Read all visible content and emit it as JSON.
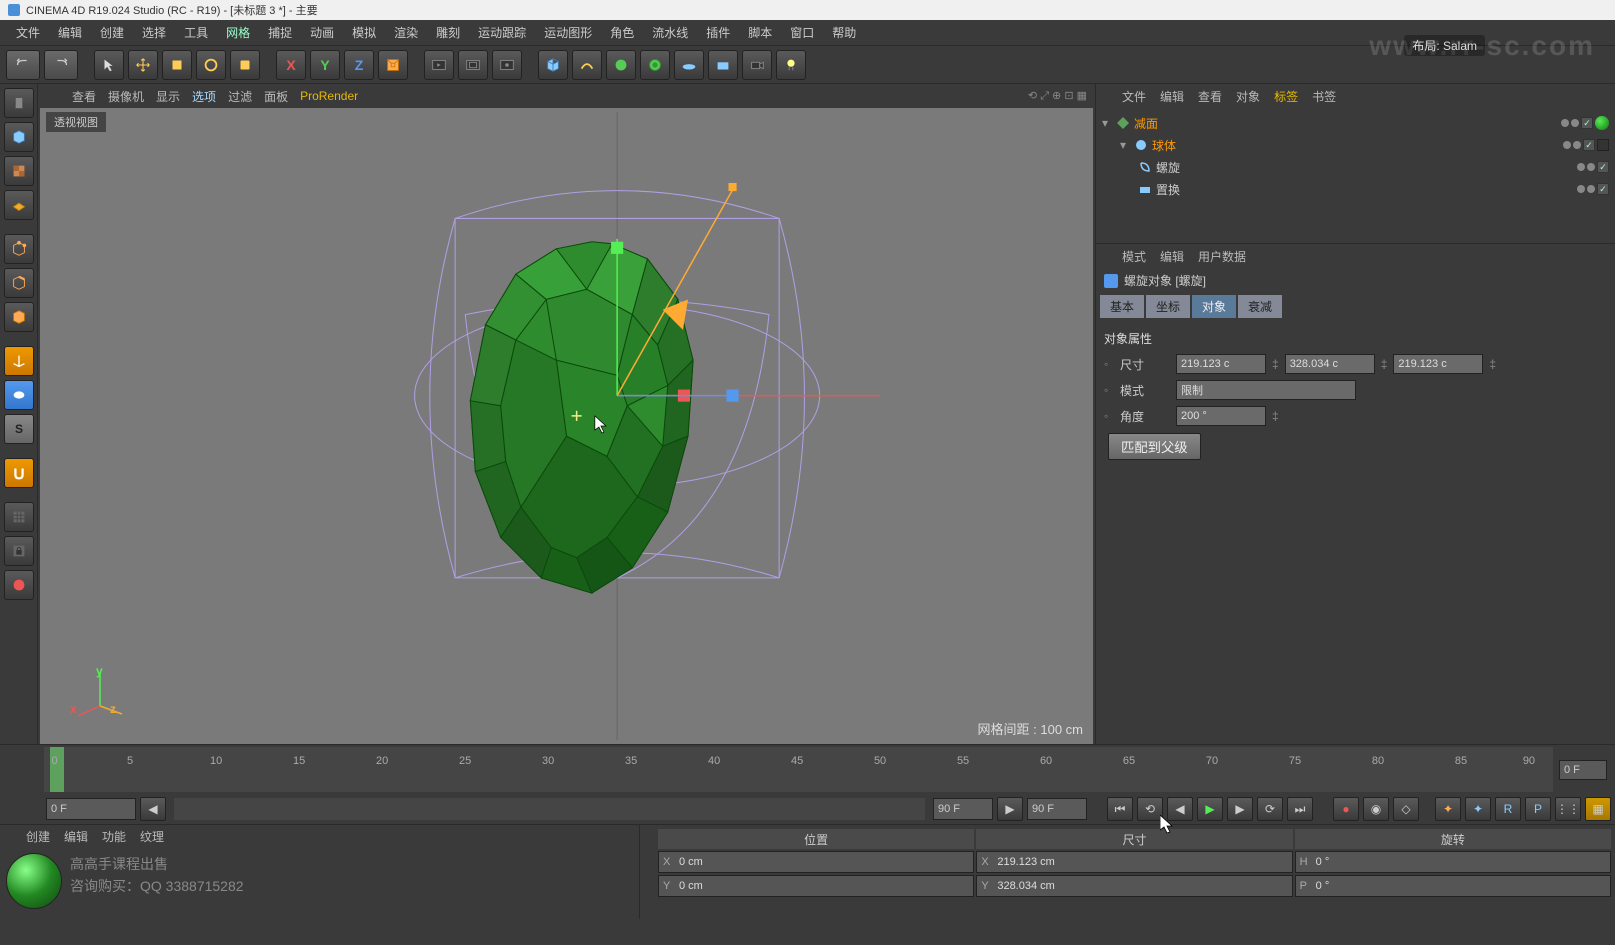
{
  "title": "CINEMA 4D R19.024 Studio (RC - R19) - [未标题 3 *] - 主要",
  "watermark": "www.rr-sc.com",
  "page_indicator": "布局: Salam",
  "menubar": [
    "文件",
    "编辑",
    "创建",
    "选择",
    "工具",
    "网格",
    "捕捉",
    "动画",
    "模拟",
    "渲染",
    "雕刻",
    "运动跟踪",
    "运动图形",
    "角色",
    "流水线",
    "插件",
    "脚本",
    "窗口",
    "帮助"
  ],
  "vp_menu": {
    "items": [
      "查看",
      "摄像机",
      "显示",
      "选项",
      "过滤",
      "面板"
    ],
    "prorender": "ProRender",
    "icons": "⟲ ⤢ ⊕ ⊡ ▦"
  },
  "viewport": {
    "label": "透视视图",
    "grid_info": "网格间距 : 100 cm"
  },
  "axis_gizmo": {
    "x": "x",
    "y": "y",
    "z": "z"
  },
  "obj_panel": {
    "menu": [
      "文件",
      "编辑",
      "查看",
      "对象",
      "标签",
      "书签"
    ],
    "tree": [
      {
        "name": "减面",
        "color": "orange",
        "indent": 0,
        "icon": "reduce"
      },
      {
        "name": "球体",
        "color": "orange",
        "indent": 1,
        "icon": "sphere"
      },
      {
        "name": "螺旋",
        "color": "normal",
        "indent": 2,
        "icon": "twist"
      },
      {
        "name": "置换",
        "color": "normal",
        "indent": 2,
        "icon": "displace"
      }
    ]
  },
  "attr_panel": {
    "menu": [
      "模式",
      "编辑",
      "用户数据"
    ],
    "title": "螺旋对象 [螺旋]",
    "tabs": [
      "基本",
      "坐标",
      "对象",
      "衰减"
    ],
    "section_title": "对象属性",
    "rows": {
      "size_label": "尺寸",
      "size_x": "219.123 c",
      "size_y": "328.034 c",
      "size_z": "219.123 c",
      "mode_label": "模式",
      "mode_value": "限制",
      "angle_label": "角度",
      "angle_value": "200 °"
    },
    "fit_btn": "匹配到父级"
  },
  "timeline": {
    "ticks": [
      "0",
      "5",
      "10",
      "15",
      "20",
      "25",
      "30",
      "35",
      "40",
      "45",
      "50",
      "55",
      "60",
      "65",
      "70",
      "75",
      "80",
      "85",
      "90"
    ],
    "end": "0 F",
    "range_start": "0 F",
    "range_end": "90 F",
    "current": "90 F"
  },
  "mat_panel": {
    "menu": [
      "创建",
      "编辑",
      "功能",
      "纹理"
    ],
    "promo_line1": "高高手课程出售",
    "promo_line2": "咨询购买：QQ 3388715282"
  },
  "coord_panel": {
    "headers": [
      "位置",
      "尺寸",
      "旋转"
    ],
    "row1": {
      "xl": "X",
      "xv": "0 cm",
      "sl": "X",
      "sv": "219.123 cm",
      "rl": "H",
      "rv": "0 °"
    },
    "row2": {
      "xl": "Y",
      "xv": "0 cm",
      "sl": "Y",
      "sv": "328.034 cm",
      "rl": "P",
      "rv": "0 °"
    }
  }
}
